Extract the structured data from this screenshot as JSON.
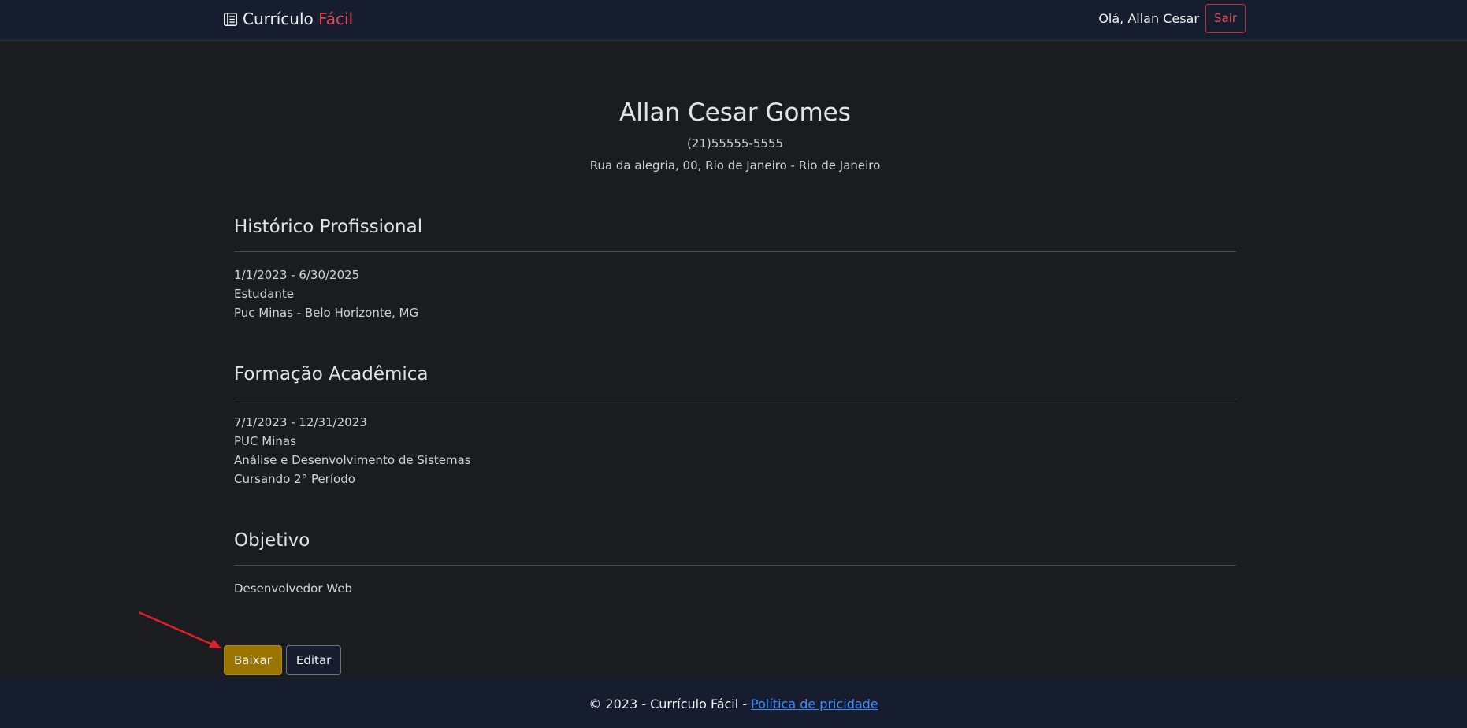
{
  "navbar": {
    "brand_main": "Currículo",
    "brand_accent": "Fácil",
    "brand_icon": "journal-icon",
    "greeting": "Olá, Allan Cesar",
    "logout_label": "Sair",
    "accent_color": "#e04b5a"
  },
  "resume": {
    "name": "Allan Cesar Gomes",
    "phone": "(21)55555-5555",
    "address": "Rua da alegria, 00, Rio de Janeiro - Rio de Janeiro",
    "sections": {
      "historico": {
        "title": "Histórico Profissional",
        "lines": [
          "1/1/2023 - 6/30/2025",
          "Estudante",
          "Puc Minas - Belo Horizonte, MG"
        ]
      },
      "formacao": {
        "title": "Formação Acadêmica",
        "lines": [
          "7/1/2023 - 12/31/2023",
          "PUC Minas",
          "Análise e Desenvolvimento de Sistemas",
          "Cursando 2° Período"
        ]
      },
      "objetivo": {
        "title": "Objetivo",
        "lines": [
          "Desenvolvedor Web"
        ]
      }
    }
  },
  "actions": {
    "download_label": "Baixar",
    "edit_label": "Editar",
    "download_color": "#9a7500"
  },
  "footer": {
    "copyright": "© 2023 - Currículo Fácil -",
    "privacy_link": "Política de pricidade",
    "link_color": "#3d8bfd"
  },
  "annotation": {
    "arrow_color": "#e0202a"
  }
}
